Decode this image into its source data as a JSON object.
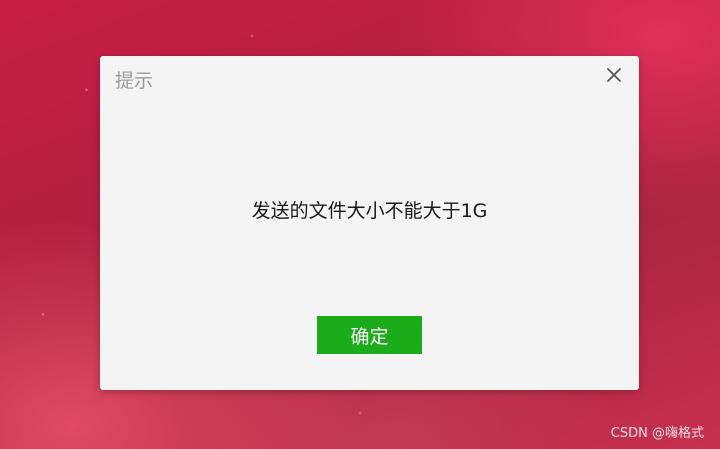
{
  "dialog": {
    "title": "提示",
    "message": "发送的文件大小不能大于1G",
    "confirm_label": "确定",
    "close_icon": "close-icon",
    "accent_color": "#1aad19"
  },
  "watermark": "CSDN @嗨格式"
}
